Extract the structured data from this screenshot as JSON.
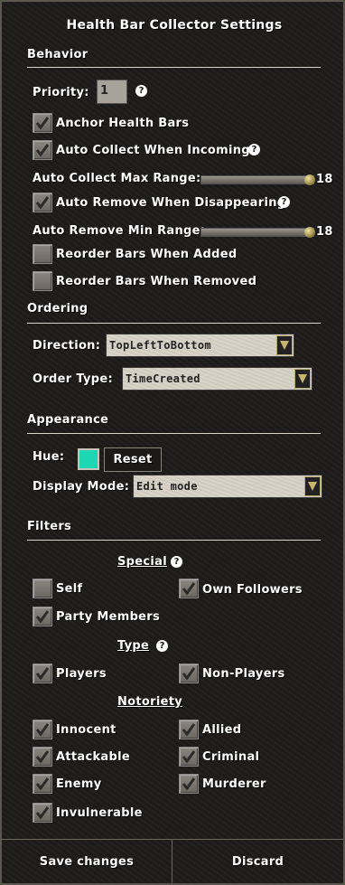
{
  "title": "Health Bar Collector Settings",
  "behavior": {
    "header": "Behavior",
    "priority_label": "Priority:",
    "priority_value": "1",
    "anchor_label": "Anchor Health Bars",
    "anchor_checked": true,
    "auto_collect_label": "Auto Collect When Incoming",
    "auto_collect_checked": true,
    "collect_range_label": "Auto Collect Max Range:",
    "collect_range_value": "18",
    "auto_remove_label": "Auto Remove When Disappearing",
    "auto_remove_checked": true,
    "remove_range_label": "Auto Remove Min Range:",
    "remove_range_value": "18",
    "reorder_added_label": "Reorder Bars When Added",
    "reorder_added_checked": false,
    "reorder_removed_label": "Reorder Bars When Removed",
    "reorder_removed_checked": false
  },
  "ordering": {
    "header": "Ordering",
    "direction_label": "Direction:",
    "direction_value": "TopLeftToBottom",
    "order_type_label": "Order Type:",
    "order_type_value": "TimeCreated"
  },
  "appearance": {
    "header": "Appearance",
    "hue_label": "Hue:",
    "hue_color": "#1fd6b2",
    "reset_label": "Reset",
    "display_mode_label": "Display Mode:",
    "display_mode_value": "Edit mode"
  },
  "filters": {
    "header": "Filters",
    "special_label": "Special",
    "self_label": "Self",
    "self_checked": false,
    "own_followers_label": "Own Followers",
    "own_followers_checked": true,
    "party_label": "Party Members",
    "party_checked": true,
    "type_label": "Type",
    "players_label": "Players",
    "players_checked": true,
    "non_players_label": "Non-Players",
    "non_players_checked": true,
    "notoriety_label": "Notoriety",
    "innocent_label": "Innocent",
    "innocent_checked": true,
    "allied_label": "Allied",
    "allied_checked": true,
    "attackable_label": "Attackable",
    "attackable_checked": true,
    "criminal_label": "Criminal",
    "criminal_checked": true,
    "enemy_label": "Enemy",
    "enemy_checked": true,
    "murderer_label": "Murderer",
    "murderer_checked": true,
    "invulnerable_label": "Invulnerable",
    "invulnerable_checked": true
  },
  "footer": {
    "save_label": "Save changes",
    "discard_label": "Discard"
  },
  "icons": {
    "help": "?"
  }
}
